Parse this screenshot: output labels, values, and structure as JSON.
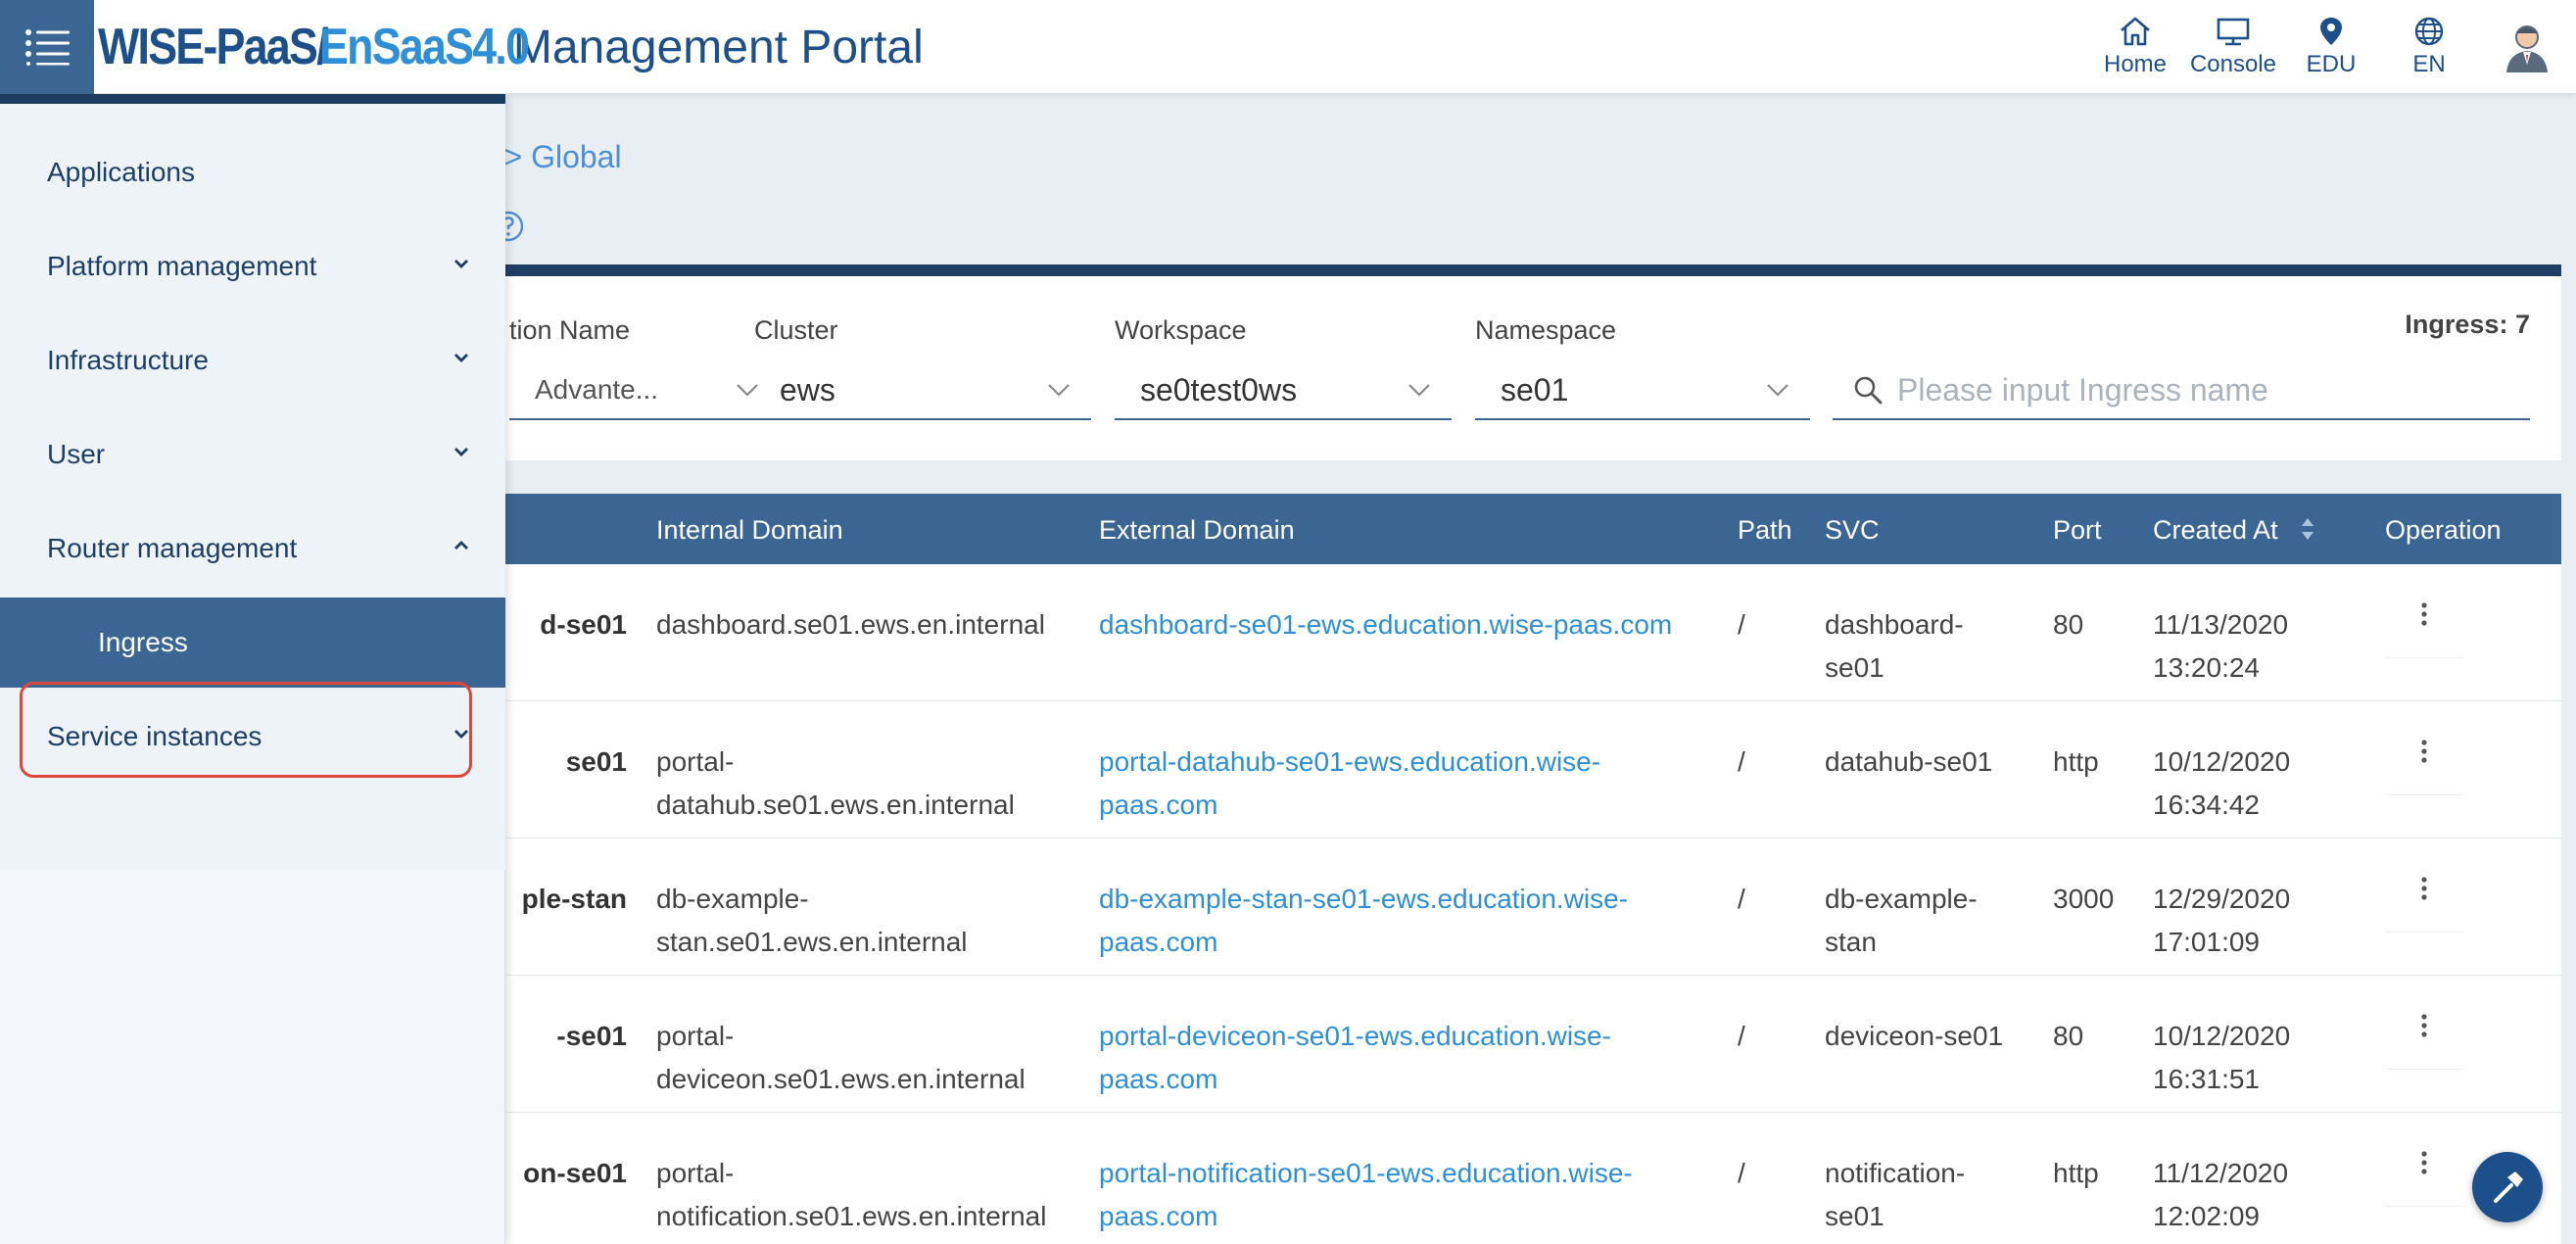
{
  "header": {
    "brand_part1": "WISE-PaaS/",
    "brand_part2": "EnSaaS4.0",
    "brand_title": "Management Portal",
    "nav": [
      {
        "label": "Home",
        "icon": "home-icon"
      },
      {
        "label": "Console",
        "icon": "monitor-icon"
      },
      {
        "label": "EDU",
        "icon": "location-pin-icon"
      },
      {
        "label": "EN",
        "icon": "globe-icon"
      }
    ],
    "avatar_icon": "user-avatar-icon"
  },
  "sidebar": {
    "items": [
      {
        "label": "Applications"
      },
      {
        "label": "Platform management"
      },
      {
        "label": "Infrastructure"
      },
      {
        "label": "User"
      },
      {
        "label": "Router management"
      },
      {
        "label": "Service instances"
      }
    ],
    "sub_items": [
      {
        "label": "Ingress",
        "active": true
      }
    ]
  },
  "breadcrumb": "ne > Global",
  "filters": {
    "subscription_label": "tion Name",
    "subscription_value": "Advante...",
    "cluster_label": "Cluster",
    "cluster_value": "ews",
    "workspace_label": "Workspace",
    "workspace_value": "se0test0ws",
    "namespace_label": "Namespace",
    "namespace_value": "se01",
    "search_placeholder": "Please input Ingress name",
    "ingress_count_label": "Ingress:",
    "ingress_count": "7"
  },
  "table": {
    "columns": {
      "internal_domain": "Internal Domain",
      "external_domain": "External Domain",
      "path": "Path",
      "svc": "SVC",
      "port": "Port",
      "created_at": "Created At",
      "operation": "Operation"
    },
    "rows": [
      {
        "name": "d-se01",
        "internal_1": "dashboard.se01.ews.en.internal",
        "internal_2": "",
        "external_1": "dashboard-se01-ews.education.wise-paas.com",
        "external_2": "",
        "path": "/",
        "svc_1": "dashboard-",
        "svc_2": "se01",
        "port": "80",
        "date": "11/13/2020",
        "time": "13:20:24"
      },
      {
        "name": "se01",
        "internal_1": "portal-",
        "internal_2": "datahub.se01.ews.en.internal",
        "external_1": "portal-datahub-se01-ews.education.wise-",
        "external_2": "paas.com",
        "path": "/",
        "svc_1": "datahub-se01",
        "svc_2": "",
        "port": "http",
        "date": "10/12/2020",
        "time": "16:34:42"
      },
      {
        "name": "ple-stan",
        "internal_1": "db-example-",
        "internal_2": "stan.se01.ews.en.internal",
        "external_1": "db-example-stan-se01-ews.education.wise-",
        "external_2": "paas.com",
        "path": "/",
        "svc_1": "db-example-",
        "svc_2": "stan",
        "port": "3000",
        "date": "12/29/2020",
        "time": "17:01:09"
      },
      {
        "name": "-se01",
        "internal_1": "portal-",
        "internal_2": "deviceon.se01.ews.en.internal",
        "external_1": "portal-deviceon-se01-ews.education.wise-",
        "external_2": "paas.com",
        "path": "/",
        "svc_1": "deviceon-se01",
        "svc_2": "",
        "port": "80",
        "date": "10/12/2020",
        "time": "16:31:51"
      },
      {
        "name": "on-se01",
        "internal_1": "portal-",
        "internal_2": "notification.se01.ews.en.internal",
        "external_1": "portal-notification-se01-ews.education.wise-",
        "external_2": "paas.com",
        "path": "/",
        "svc_1": "notification-",
        "svc_2": "se01",
        "port": "http",
        "date": "11/12/2020",
        "time": "12:02:09"
      }
    ]
  },
  "colors": {
    "primary": "#3b6593",
    "dark_navy": "#1f3e63",
    "link": "#2f8fd6",
    "highlight": "#e0473b"
  }
}
